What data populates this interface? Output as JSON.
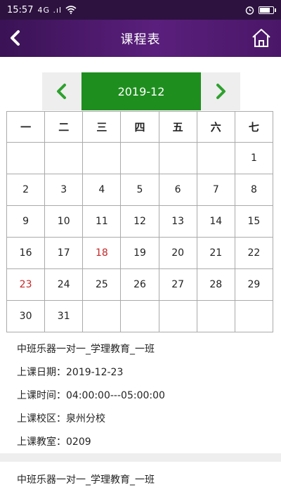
{
  "status_bar": {
    "time": "15:57",
    "signal": "4G .ıl",
    "wifi_icon": "wifi-icon",
    "alarm_icon": "alarm-icon",
    "battery_level": 0.8
  },
  "header": {
    "title": "课程表",
    "back_icon": "chevron-left-icon",
    "home_icon": "home-icon",
    "bg_color": "#4a1768"
  },
  "calendar": {
    "month_label": "2019-12",
    "accent_color": "#1e8e1e",
    "highlight_color": "#c62828",
    "weekdays": [
      "一",
      "二",
      "三",
      "四",
      "五",
      "六",
      "七"
    ],
    "weeks": [
      [
        "",
        "",
        "",
        "",
        "",
        "",
        "1"
      ],
      [
        "2",
        "3",
        "4",
        "5",
        "6",
        "7",
        "8"
      ],
      [
        "9",
        "10",
        "11",
        "12",
        "13",
        "14",
        "15"
      ],
      [
        "16",
        "17",
        "18",
        "19",
        "20",
        "21",
        "22"
      ],
      [
        "23",
        "24",
        "25",
        "26",
        "27",
        "28",
        "29"
      ],
      [
        "30",
        "31",
        "",
        "",
        "",
        "",
        ""
      ]
    ],
    "highlighted_days": [
      "18",
      "23"
    ]
  },
  "courses": [
    {
      "name": "中班乐器一对一_学理教育_一班",
      "date": "上课日期：2019-12-23",
      "time": "上课时间：04:00:00---05:00:00",
      "campus": "上课校区：泉州分校",
      "room": "上课教室：0209"
    },
    {
      "name": "中班乐器一对一_学理教育_一班"
    }
  ]
}
